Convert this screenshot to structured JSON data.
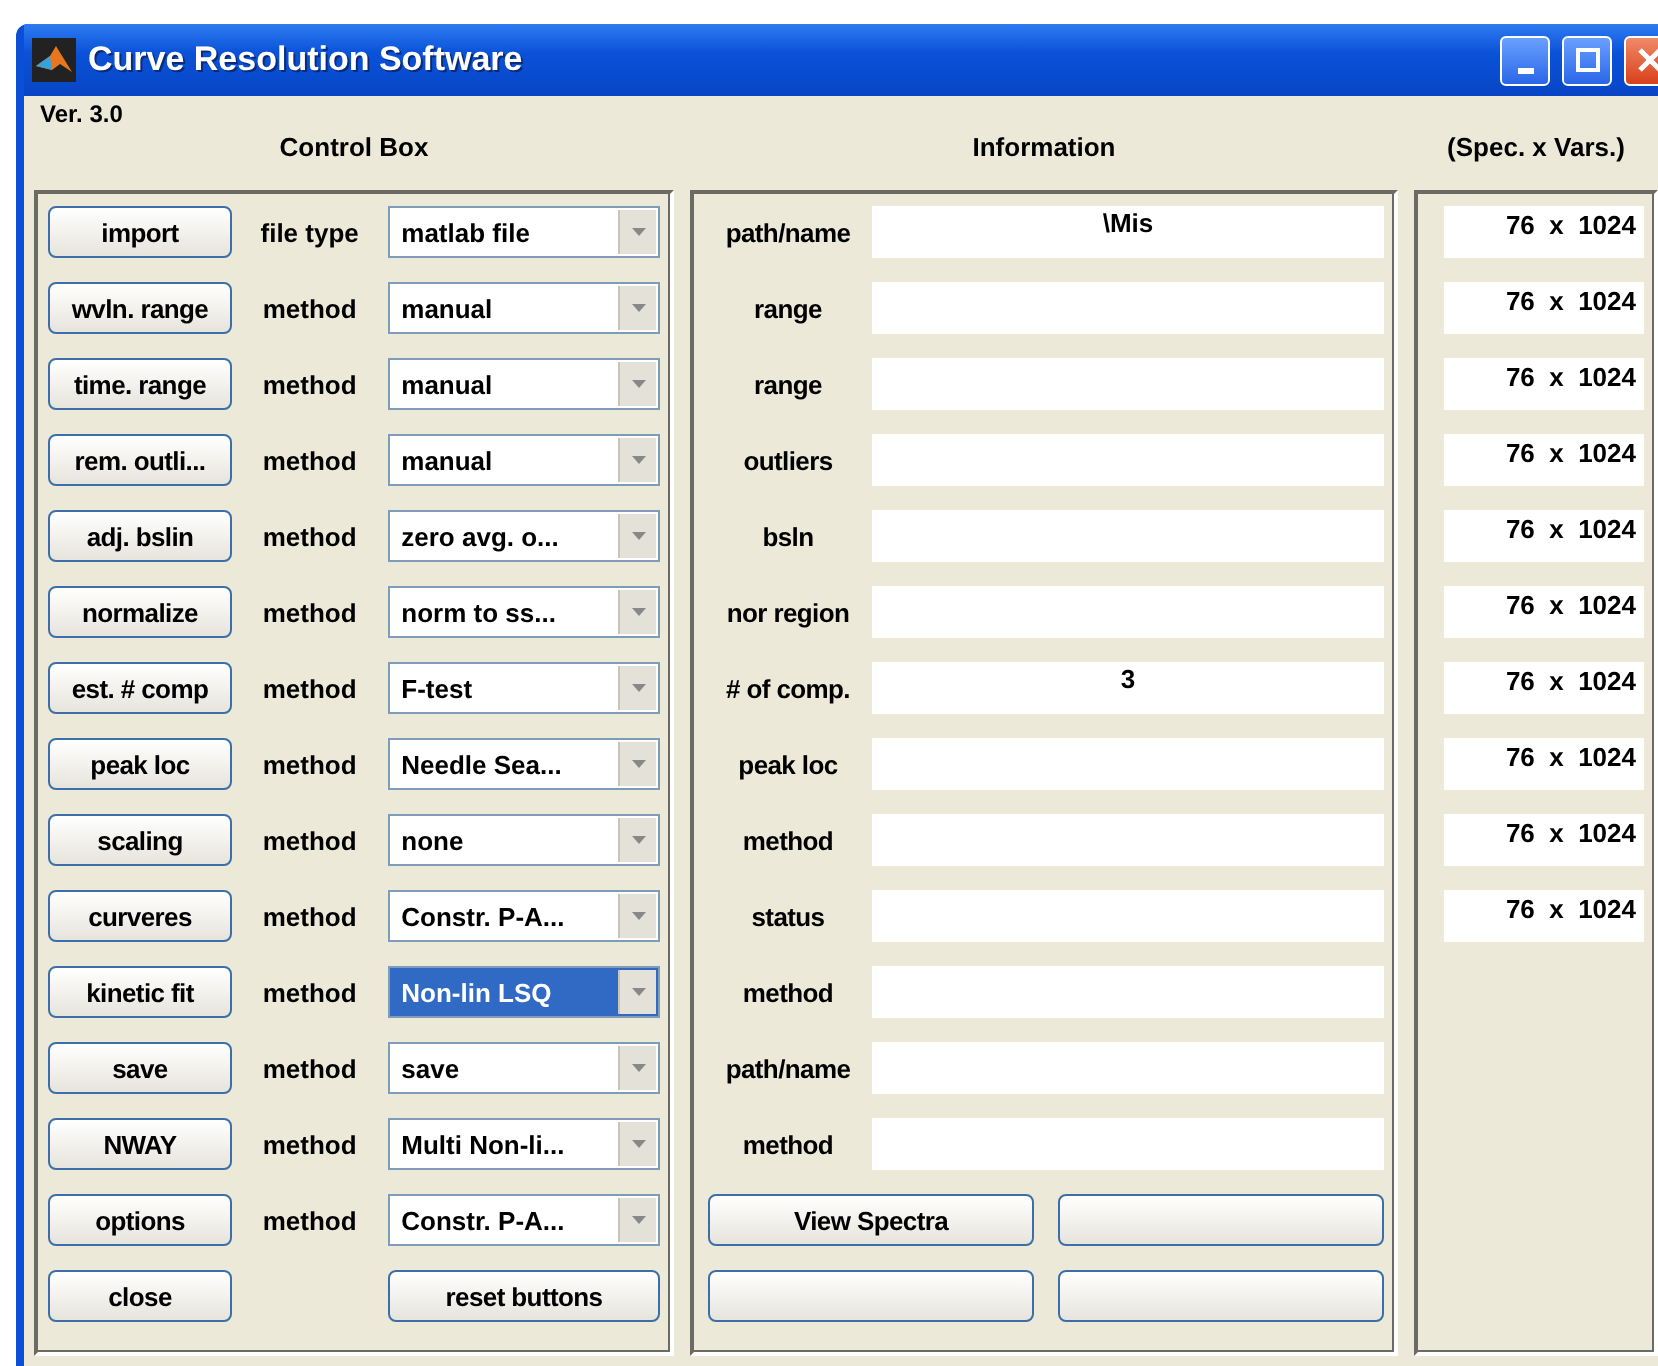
{
  "window": {
    "title": "Curve Resolution Software"
  },
  "version": "Ver. 3.0",
  "headers": {
    "control": "Control Box",
    "information": "Information",
    "dims": "(Spec. x Vars.)"
  },
  "controls": [
    {
      "button": "import",
      "label": "file type",
      "value": "matlab file",
      "selected": false
    },
    {
      "button": "wvln. range",
      "label": "method",
      "value": "manual",
      "selected": false
    },
    {
      "button": "time. range",
      "label": "method",
      "value": "manual",
      "selected": false
    },
    {
      "button": "rem. outli...",
      "label": "method",
      "value": "manual",
      "selected": false
    },
    {
      "button": "adj. bslin",
      "label": "method",
      "value": "zero avg. o...",
      "selected": false
    },
    {
      "button": "normalize",
      "label": "method",
      "value": "norm to ss...",
      "selected": false
    },
    {
      "button": "est. # comp",
      "label": "method",
      "value": "F-test",
      "selected": false
    },
    {
      "button": "peak loc",
      "label": "method",
      "value": "Needle Sea...",
      "selected": false
    },
    {
      "button": "scaling",
      "label": "method",
      "value": "none",
      "selected": false
    },
    {
      "button": "curveres",
      "label": "method",
      "value": "Constr. P-A...",
      "selected": false
    },
    {
      "button": "kinetic fit",
      "label": "method",
      "value": "Non-lin LSQ",
      "selected": true
    },
    {
      "button": "save",
      "label": "method",
      "value": "save",
      "selected": false
    },
    {
      "button": "NWAY",
      "label": "method",
      "value": "Multi Non-li...",
      "selected": false
    },
    {
      "button": "options",
      "label": "method",
      "value": "Constr. P-A...",
      "selected": false
    }
  ],
  "bottom_buttons": [
    "close",
    "reset buttons"
  ],
  "info": [
    {
      "label": "path/name",
      "value": "\\Mis"
    },
    {
      "label": "range"
    },
    {
      "label": "range"
    },
    {
      "label": "outliers"
    },
    {
      "label": "bsln"
    },
    {
      "label": "nor region"
    },
    {
      "label": "# of comp.",
      "value": "3"
    },
    {
      "label": "peak loc"
    },
    {
      "label": "method"
    },
    {
      "label": "status"
    },
    {
      "label": "method"
    },
    {
      "label": "path/name"
    },
    {
      "label": "method"
    }
  ],
  "info_buttons": [
    {
      "kind": "labeled",
      "label": "View Spectra"
    },
    {
      "kind": "blank"
    },
    {
      "kind": "blank"
    },
    {
      "kind": "blank"
    }
  ],
  "dims": [
    "76  x  1024",
    "76  x  1024",
    "76  x  1024",
    "76  x  1024",
    "76  x  1024",
    "76  x  1024",
    "76  x  1024",
    "76  x  1024",
    "76  x  1024",
    "76  x  1024"
  ]
}
